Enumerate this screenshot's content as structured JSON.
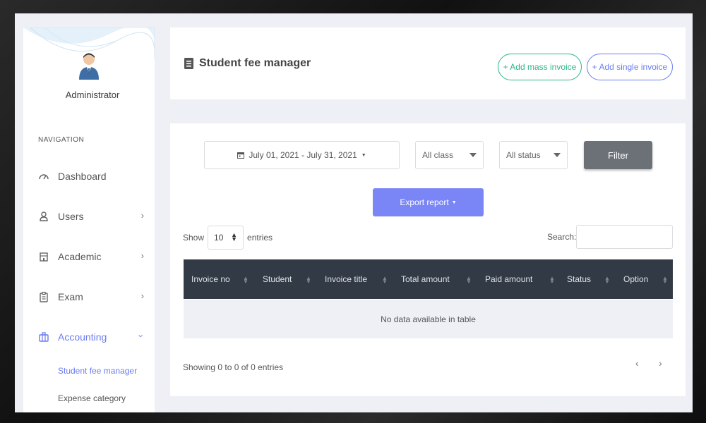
{
  "sidebar": {
    "user_name": "Administrator",
    "nav_heading": "NAVIGATION",
    "items": [
      {
        "label": "Dashboard",
        "icon": "gauge-icon"
      },
      {
        "label": "Users",
        "icon": "user-icon"
      },
      {
        "label": "Academic",
        "icon": "building-icon"
      },
      {
        "label": "Exam",
        "icon": "clipboard-icon"
      },
      {
        "label": "Accounting",
        "icon": "briefcase-icon"
      }
    ],
    "sub_items": [
      {
        "label": "Student fee manager"
      },
      {
        "label": "Expense category"
      }
    ]
  },
  "header": {
    "title": "Student fee manager",
    "icon": "document-icon",
    "add_mass_label": "+ Add mass invoice",
    "add_single_label": "+ Add single invoice"
  },
  "filters": {
    "date_range": "July 01, 2021 - July 31, 2021",
    "class_value": "All class",
    "status_value": "All status",
    "filter_label": "Filter",
    "export_label": "Export report"
  },
  "table": {
    "show_label": "Show",
    "entries_value": "10",
    "entries_label": "entries",
    "search_label": "Search:",
    "columns": [
      "Invoice no",
      "Student",
      "Invoice title",
      "Total amount",
      "Paid amount",
      "Status",
      "Option"
    ],
    "empty_text": "No data available in table",
    "info": "Showing 0 to 0 of 0 entries",
    "prev": "‹",
    "next": "›"
  },
  "colors": {
    "accent": "#6a7cf0",
    "success": "#2bb58a",
    "table_head": "#323a46",
    "filter_button": "#6b7177",
    "export_button": "#7a86f5"
  }
}
